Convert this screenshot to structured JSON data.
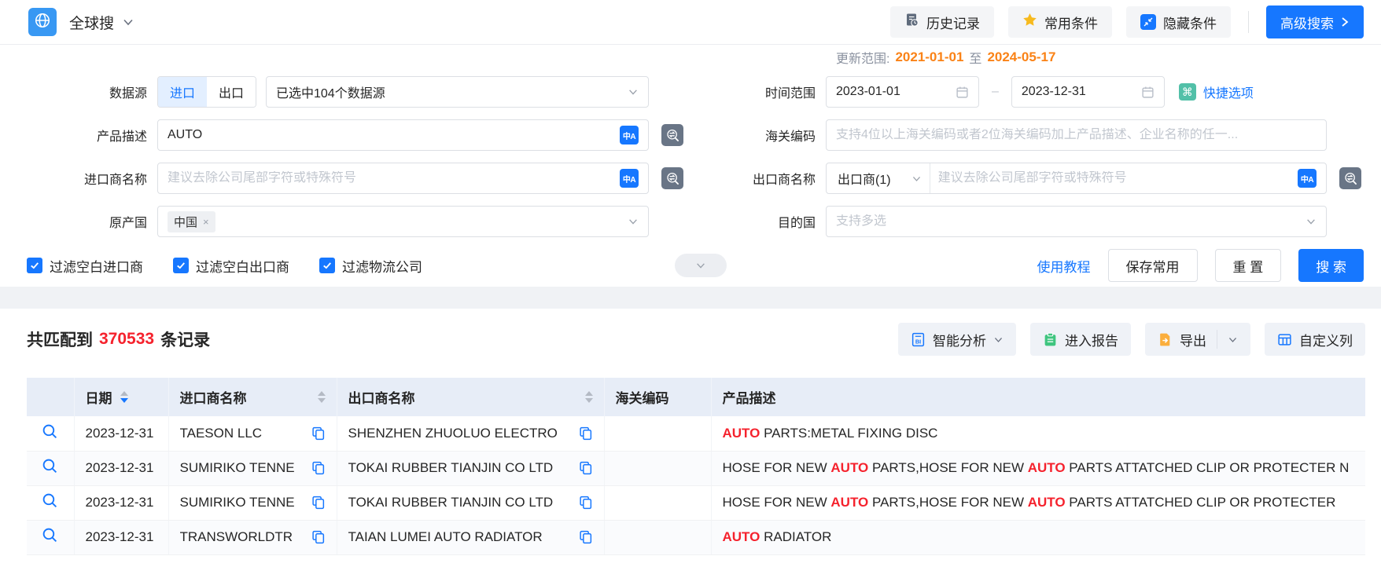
{
  "colors": {
    "primary": "#1677ff",
    "date_orange": "#fa8216",
    "highlight_red": "#f5222d",
    "quick_teal": "#52c0a8",
    "report_green": "#3fc57f",
    "export_orange": "#fbae3c"
  },
  "topbar": {
    "app_name": "全球搜",
    "history": "历史记录",
    "favorites": "常用条件",
    "hide_conditions": "隐藏条件",
    "advanced_search": "高级搜索"
  },
  "form": {
    "data_source": {
      "label": "数据源",
      "import_tab": "进口",
      "export_tab": "出口",
      "selected_text": "已选中104个数据源"
    },
    "product_desc": {
      "label": "产品描述",
      "value": "AUTO"
    },
    "importer": {
      "label": "进口商名称",
      "placeholder": "建议去除公司尾部字符或特殊符号"
    },
    "origin_country": {
      "label": "原产国",
      "tag": "中国",
      "remove": "×"
    },
    "update_range": {
      "label": "更新范围:",
      "start": "2021-01-01",
      "to": "至",
      "end": "2024-05-17"
    },
    "time_range": {
      "label": "时间范围",
      "start": "2023-01-01",
      "end": "2023-12-31",
      "dash": "–",
      "quick_label": "快捷选项",
      "quick_glyph": "⌘"
    },
    "hs_code": {
      "label": "海关编码",
      "placeholder": "支持4位以上海关编码或者2位海关编码加上产品描述、企业名称的任一..."
    },
    "exporter": {
      "label": "出口商名称",
      "select_value": "出口商(1)",
      "placeholder": "建议去除公司尾部字符或特殊符号"
    },
    "dest_country": {
      "label": "目的国",
      "placeholder": "支持多选"
    },
    "filters": [
      {
        "label": "过滤空白进口商",
        "checked": true
      },
      {
        "label": "过滤空白出口商",
        "checked": true
      },
      {
        "label": "过滤物流公司",
        "checked": true
      }
    ],
    "tutorial_link": "使用教程",
    "save_button": "保存常用",
    "reset_button": "重 置",
    "search_button": "搜 索",
    "translate_glyph": "中A"
  },
  "results": {
    "count_prefix": "共匹配到",
    "count": "370533",
    "count_suffix": "条记录",
    "analysis_button": "智能分析",
    "report_button": "进入报告",
    "export_button": "导出",
    "columns_button": "自定义列"
  },
  "table": {
    "headers": {
      "date": "日期",
      "importer": "进口商名称",
      "exporter": "出口商名称",
      "hs_code": "海关编码",
      "product": "产品描述"
    },
    "rows": [
      {
        "date": "2023-12-31",
        "importer": "TAESON LLC",
        "exporter": "SHENZHEN ZHUOLUO ELECTRO",
        "hs_code": "",
        "product": [
          {
            "t": "AUTO",
            "hl": true
          },
          {
            "t": " PARTS:METAL FIXING DISC",
            "hl": false
          }
        ]
      },
      {
        "date": "2023-12-31",
        "importer": "SUMIRIKO TENNE",
        "exporter": "TOKAI RUBBER TIANJIN CO LTD",
        "hs_code": "",
        "product": [
          {
            "t": "HOSE FOR NEW ",
            "hl": false
          },
          {
            "t": "AUTO",
            "hl": true
          },
          {
            "t": " PARTS,HOSE FOR NEW ",
            "hl": false
          },
          {
            "t": "AUTO",
            "hl": true
          },
          {
            "t": " PARTS ATTATCHED CLIP OR PROTECTER N",
            "hl": false
          }
        ]
      },
      {
        "date": "2023-12-31",
        "importer": "SUMIRIKO TENNE",
        "exporter": "TOKAI RUBBER TIANJIN CO LTD",
        "hs_code": "",
        "product": [
          {
            "t": "HOSE FOR NEW ",
            "hl": false
          },
          {
            "t": "AUTO",
            "hl": true
          },
          {
            "t": " PARTS,HOSE FOR NEW ",
            "hl": false
          },
          {
            "t": "AUTO",
            "hl": true
          },
          {
            "t": " PARTS ATTATCHED CLIP OR PROTECTER",
            "hl": false
          }
        ]
      },
      {
        "date": "2023-12-31",
        "importer": "TRANSWORLDTR",
        "exporter": "TAIAN LUMEI AUTO RADIATOR",
        "hs_code": "",
        "product": [
          {
            "t": "AUTO",
            "hl": true
          },
          {
            "t": " RADIATOR",
            "hl": false
          }
        ]
      }
    ]
  }
}
